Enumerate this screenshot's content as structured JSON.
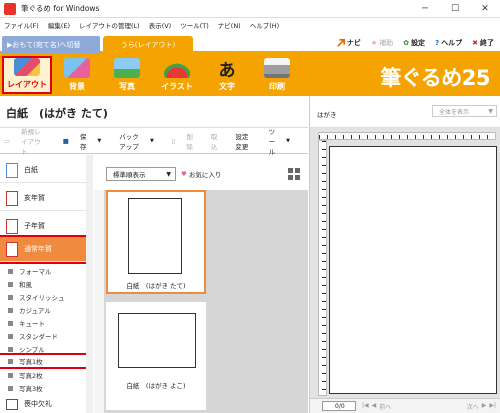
{
  "window": {
    "title": "筆ぐるめ for Windows",
    "minimize_icon": "minimize-icon",
    "maximize_icon": "maximize-icon",
    "close_icon": "close-icon"
  },
  "menu": [
    "ファイル(F)",
    "編集(E)",
    "レイアウトの管理(L)",
    "表示(V)",
    "ツール(T)",
    "ナビ(N)",
    "ヘルプ(H)"
  ],
  "tabs": {
    "switch_label": "▶おもて(宛て名)へ切替",
    "active_label": "うら(レイアウト)"
  },
  "toplinks": {
    "navi": "ナビ",
    "assist": "補助",
    "settings": "設定",
    "help": "ヘルプ",
    "exit": "終了"
  },
  "toolbar": {
    "buttons": [
      "レイアウト",
      "背景",
      "写真",
      "イラスト",
      "文字",
      "印刷"
    ],
    "brand": "筆ぐるめ25"
  },
  "paper": {
    "title": "白紙　(はがき たて)"
  },
  "actions": {
    "new_layout": "新規レイアウト",
    "save": "保存",
    "backup": "バックアップ",
    "delete": "削除",
    "import": "取込",
    "setting_change": "設定変更",
    "tools": "ツール"
  },
  "categories": {
    "blank": "白紙",
    "tori_nenga": "亥年賀",
    "ne_nenga": "子年賀",
    "regular_nenga": "通常年賀",
    "subs": [
      "フォーマル",
      "和風",
      "スタイリッシュ",
      "カジュアル",
      "キュート",
      "スタンダード",
      "シンプル",
      "写真1枚",
      "写真2枚",
      "写真3枚"
    ],
    "mourning": "喪中欠礼"
  },
  "templates": {
    "sort_label": "標準順表示",
    "favorites_label": "お気に入り",
    "card1_label": "白紙　(はがき たて)",
    "card2_label": "白紙　(はがき よこ)"
  },
  "preview": {
    "label": "はがき",
    "zoom_value": "全体を表示",
    "page_indicator": "0/0",
    "prev_label": "前へ",
    "next_label": "次へ"
  },
  "colors": {
    "accent": "#f5a300",
    "selection": "#e0000c",
    "selected_category": "#f08a3e",
    "tab_switch": "#8fa9d8"
  }
}
